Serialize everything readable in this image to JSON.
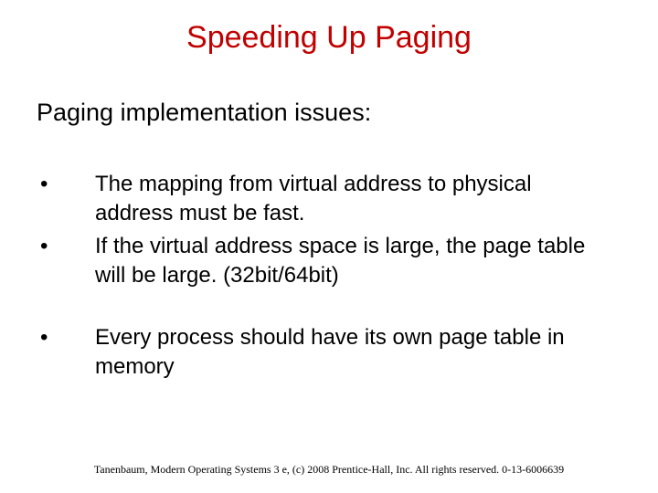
{
  "title": "Speeding Up Paging",
  "subheading": "Paging implementation issues:",
  "bullets": [
    {
      "text": "The mapping from virtual address to physical address must be fast."
    },
    {
      "text": "If the virtual address space is large, the page table will be large. (32bit/64bit)"
    },
    {
      "text": "Every process should have its own page table in memory"
    }
  ],
  "footer": "Tanenbaum, Modern Operating Systems 3 e, (c) 2008 Prentice-Hall, Inc. All rights reserved. 0-13-6006639"
}
